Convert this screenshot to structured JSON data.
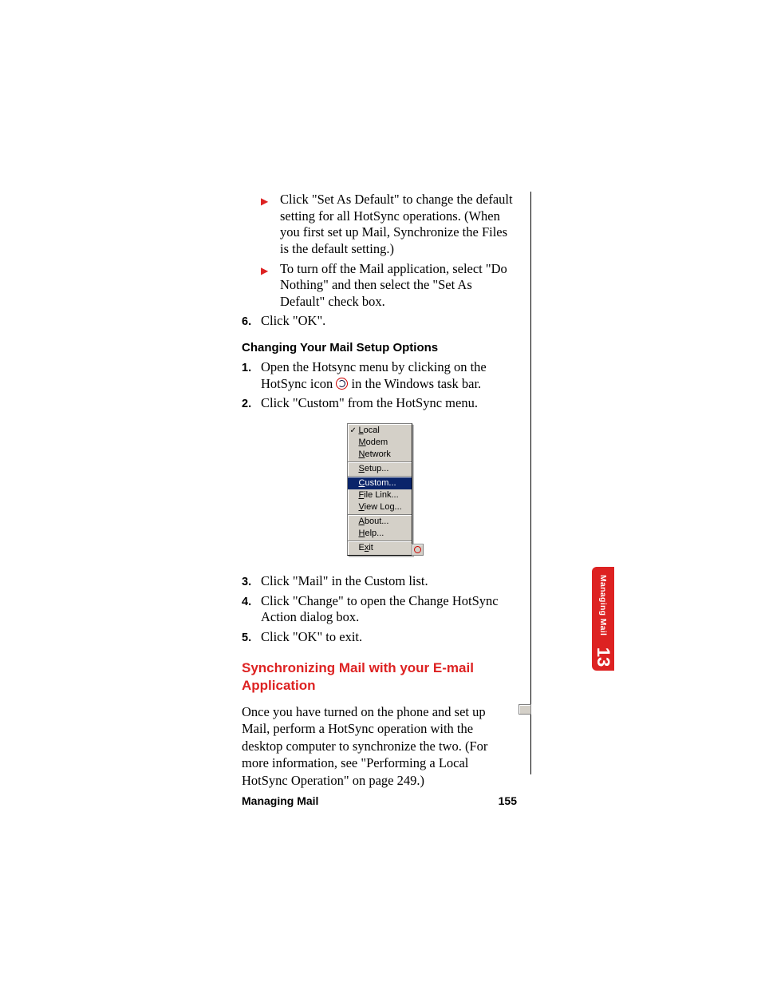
{
  "bullets": [
    "Click \"Set As Default\" to change the default setting for all HotSync operations. (When you first set up Mail, Synchronize the Files is the default setting.)",
    "To turn off the Mail application, select \"Do Nothing\" and then select the \"Set As Default\" check box."
  ],
  "step6_num": "6.",
  "step6_text": "Click \"OK\".",
  "heading_change": "Changing Your Mail Setup Options",
  "change_steps": [
    {
      "num": "1.",
      "text_before": "Open the Hotsync menu by clicking on the HotSync icon ",
      "text_after": " in the Windows task bar."
    },
    {
      "num": "2.",
      "text": "Click \"Custom\" from the HotSync menu."
    }
  ],
  "menu": {
    "groups": [
      [
        {
          "label": "Local",
          "ul_index": 0,
          "checked": true
        },
        {
          "label": "Modem",
          "ul_index": 0
        },
        {
          "label": "Network",
          "ul_index": 0
        }
      ],
      [
        {
          "label": "Setup...",
          "ul_index": 0
        }
      ],
      [
        {
          "label": "Custom...",
          "ul_index": 0,
          "selected": true
        },
        {
          "label": "File Link...",
          "ul_index": 0
        },
        {
          "label": "View Log...",
          "ul_index": 0
        }
      ],
      [
        {
          "label": "About...",
          "ul_index": 0
        },
        {
          "label": "Help...",
          "ul_index": 0
        }
      ],
      [
        {
          "label": "Exit",
          "ul_index": 1
        }
      ]
    ]
  },
  "after_steps": [
    {
      "num": "3.",
      "text": "Click \"Mail\" in the Custom list."
    },
    {
      "num": "4.",
      "text": "Click \"Change\" to open the Change HotSync Action dialog box."
    },
    {
      "num": "5.",
      "text": "Click \"OK\" to exit."
    }
  ],
  "heading_sync": "Synchronizing Mail with your E-mail Application",
  "sync_para": "Once you have turned on the phone and set up Mail, perform a HotSync operation with the desktop computer to synchronize the two. (For more information, see \"Performing a Local HotSync Operation\" on page 249.)",
  "footer_label": "Managing Mail",
  "footer_page": "155",
  "sidetab_label": "Managing Mail",
  "sidetab_chapter": "13"
}
